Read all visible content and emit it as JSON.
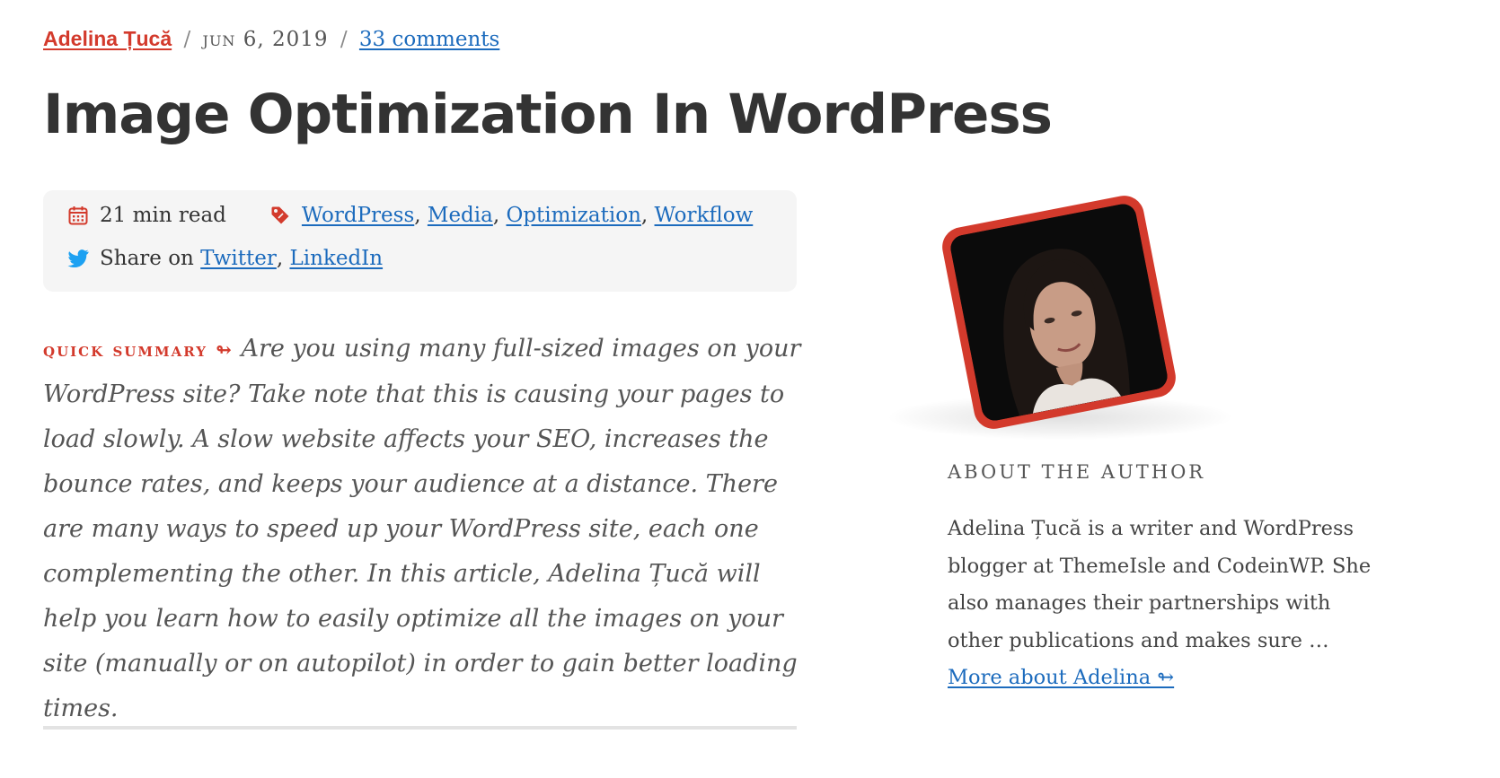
{
  "byline": {
    "author": "Adelina Țucă",
    "separator": "/",
    "date_month": "Jun",
    "date_rest": "6, 2019",
    "comments": "33 comments"
  },
  "article": {
    "title": "Image Optimization In WordPress"
  },
  "meta": {
    "read_time": "21 min read",
    "tags": [
      "WordPress",
      "Media",
      "Optimization",
      "Workflow"
    ],
    "tag_separator": ",",
    "share_label": "Share on",
    "share_links": [
      "Twitter",
      "LinkedIn"
    ]
  },
  "summary": {
    "label": "Quick summary",
    "arrow": "↬",
    "text": "Are you using many full-sized images on your WordPress site? Take note that this is causing your pages to load slowly. A slow website affects your SEO, increases the bounce rates, and keeps your audience at a distance. There are many ways to speed up your WordPress site, each one complementing the other. In this article, Adelina Țucă will help you learn how to easily optimize all the images on your site (manually or on autopilot) in order to gain better loading times."
  },
  "author_box": {
    "label": "About The Author",
    "bio": "Adelina Țucă is a writer and WordPress blogger at ThemeIsle and CodeinWP. She also manages their partnerships with other publications and makes sure …",
    "more_link": "More about Adelina ↬"
  },
  "icons": {
    "read_time": "calendar-icon",
    "tags": "tag-icon",
    "share": "twitter-icon"
  },
  "colors": {
    "accent": "#d33a2c",
    "link": "#1c6bbd",
    "twitter": "#1da1f2",
    "meta_bg": "#f5f5f5"
  }
}
